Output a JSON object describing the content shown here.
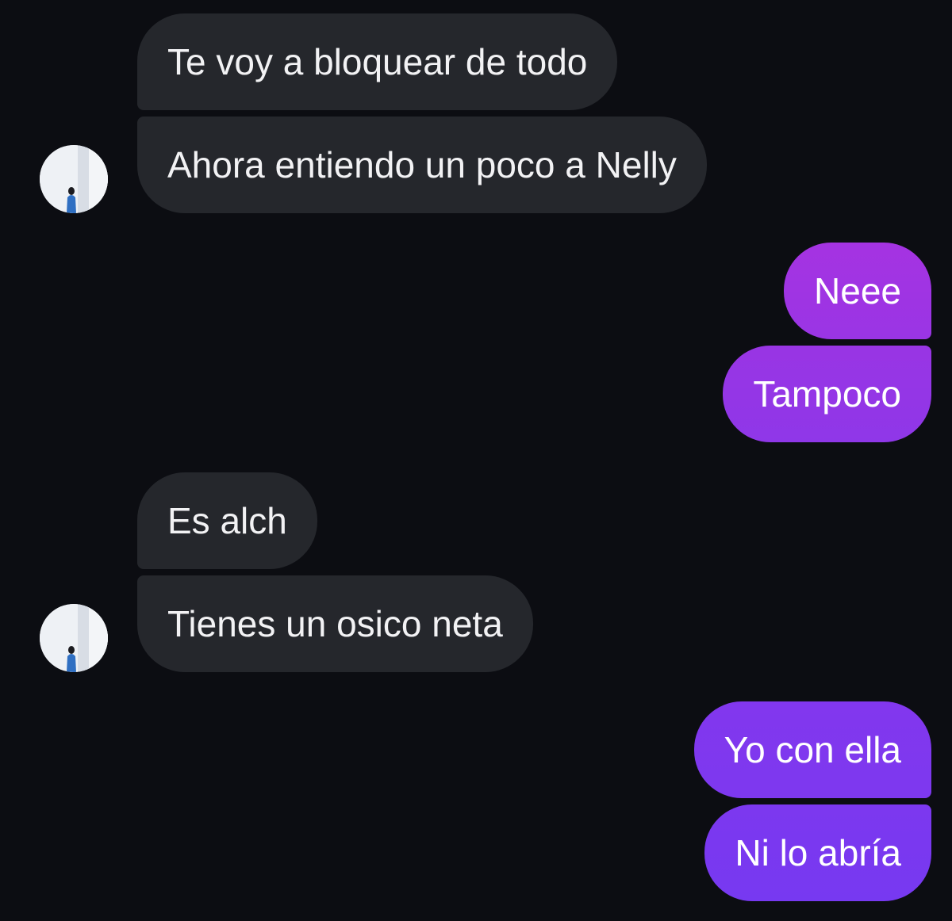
{
  "chat": {
    "messages": [
      {
        "sender": "contact",
        "text": "Te voy a bloquear de todo"
      },
      {
        "sender": "contact",
        "text": "Ahora entiendo un poco a Nelly"
      },
      {
        "sender": "me",
        "text": "Neee"
      },
      {
        "sender": "me",
        "text": "Tampoco"
      },
      {
        "sender": "contact",
        "text": "Es alch"
      },
      {
        "sender": "contact",
        "text": "Tienes un osico neta"
      },
      {
        "sender": "me",
        "text": "Yo con ella"
      },
      {
        "sender": "me",
        "text": "Ni lo abría"
      }
    ]
  },
  "colors": {
    "background": "#0c0d12",
    "incoming_bubble": "#25272c",
    "outgoing_gradient_top": "#a333e0",
    "outgoing_gradient_bottom": "#7a3bf0"
  },
  "icons": {
    "avatar": "contact-avatar-photo"
  }
}
